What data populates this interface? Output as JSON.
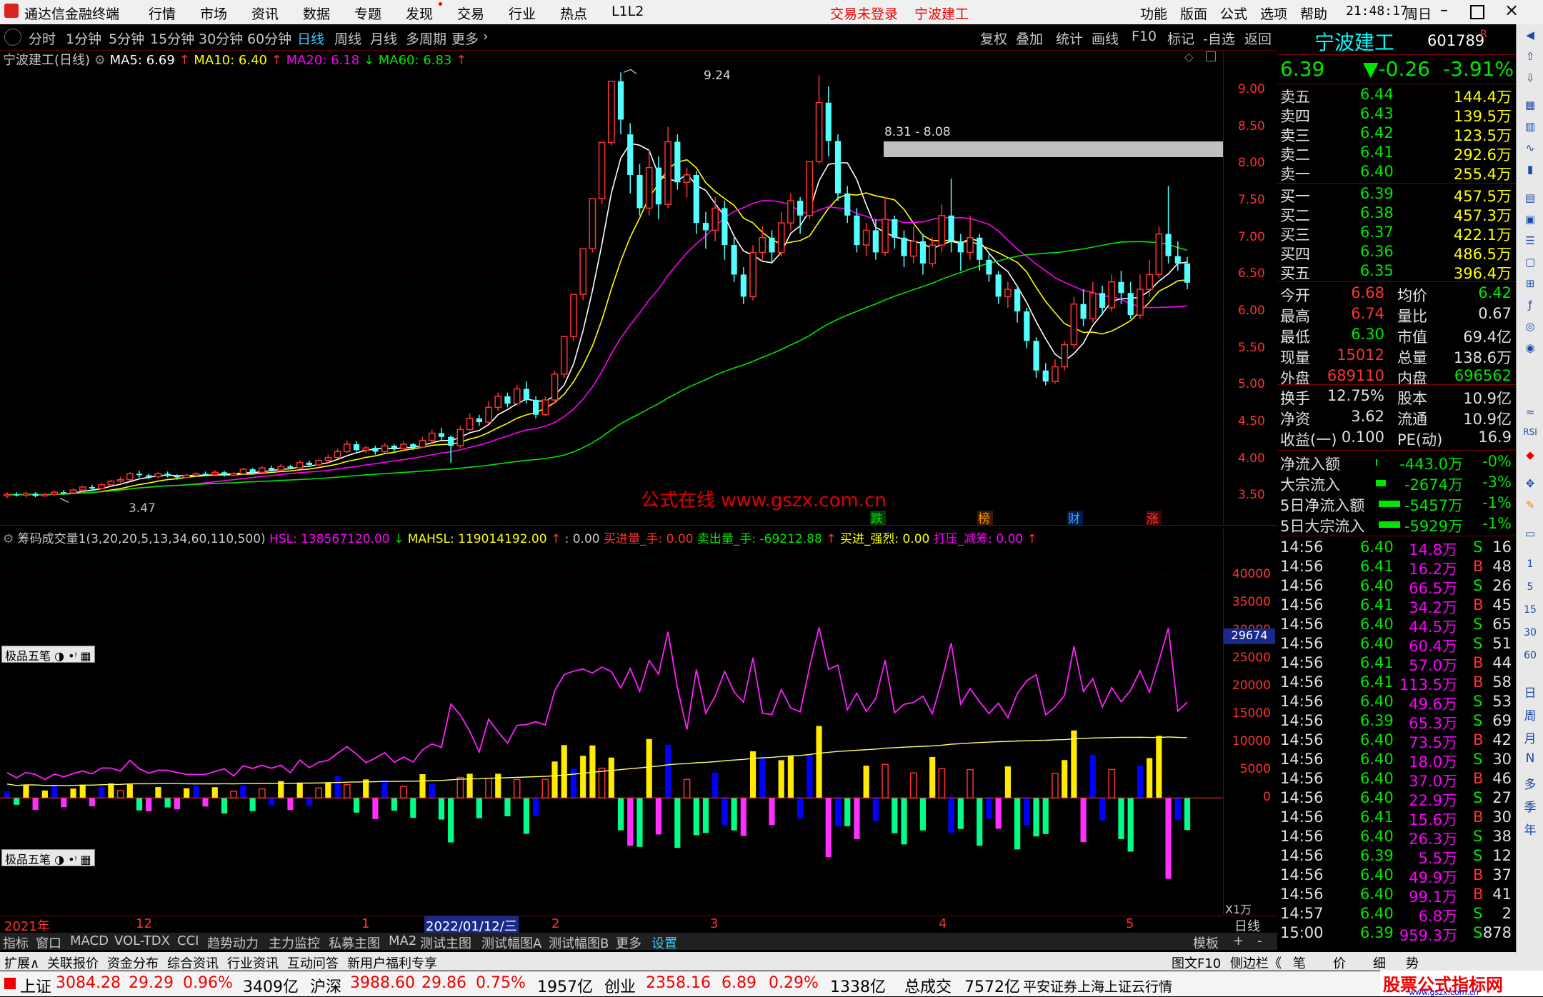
{
  "titlebar": {
    "app_name": "通达信金融终端",
    "menu": [
      "行情",
      "市场",
      "资讯",
      "数据",
      "专题",
      "发现",
      "交易",
      "行业",
      "热点",
      "L1L2"
    ],
    "login_status": "交易未登录",
    "stock": "宁波建工",
    "right_menu": [
      "功能",
      "版面",
      "公式",
      "选项",
      "帮助"
    ],
    "clock": "21:48:17",
    "weekday": "周日"
  },
  "period_tabs": [
    "分时",
    "1分钟",
    "5分钟",
    "15分钟",
    "30分钟",
    "60分钟",
    "日线",
    "周线",
    "月线",
    "多周期",
    "更多"
  ],
  "period_active": "日线",
  "tools": [
    "复权",
    "叠加",
    "统计",
    "画线",
    "F10",
    "标记",
    "-自选",
    "返回"
  ],
  "main_legend": {
    "name": "宁波建工(日线)",
    "ma5": "MA5: 6.69",
    "ma10": "MA10: 6.40",
    "ma20": "MA20: 6.18",
    "ma60": "MA60: 6.83"
  },
  "price_axis": [
    "9.00",
    "8.50",
    "8.00",
    "7.50",
    "7.00",
    "6.50",
    "6.00",
    "5.50",
    "5.00",
    "4.50",
    "4.00",
    "3.50"
  ],
  "annotations": {
    "high": "9.24",
    "low": "3.47",
    "zone": "8.31 - 8.08",
    "watermark": "公式在线  www.gszx.com.cn",
    "events": [
      "跌",
      "榜",
      "财",
      "涨"
    ]
  },
  "sub_legend": {
    "name": "筹码成交量1(3,20,20,5,13,34,60,110,500)",
    "hsl": "HSL: 138567120.00",
    "mahsl": "MAHSL: 119014192.00",
    "zero": ": 0.00",
    "buy_in": "买进量_手: 0.00",
    "sell_out": "卖出量_手: -69212.88",
    "buy_strong": "买进_强烈: 0.00",
    "press": "打压_减筹: 0.00"
  },
  "sub_axis": [
    "40000",
    "35000",
    "30000",
    "25000",
    "20000",
    "15000",
    "10000",
    "5000",
    "0"
  ],
  "sub_marker": "29674",
  "x1wan": "X1万",
  "tool_label": "极品五笔",
  "date_axis": {
    "labels": [
      "2021年",
      "12",
      "1",
      "2022/01/12/三",
      "2",
      "3",
      "4",
      "5"
    ],
    "period": "日线"
  },
  "bottom_tabs": [
    "指标",
    "窗口",
    "MACD",
    "VOL-TDX",
    "CCI",
    "趋势动力",
    "主力监控",
    "私募主图",
    "MA2",
    "测试主图",
    "测试幅图A",
    "测试幅图B",
    "更多",
    "设置"
  ],
  "bottom_right": [
    "模板",
    "+",
    "-"
  ],
  "ext_bar": [
    "扩展∧",
    "关联报价",
    "资金分布",
    "综合资讯",
    "行业资讯",
    "互动问答",
    "新用户福利专享"
  ],
  "ext_right": [
    "图文F10",
    "侧边栏《",
    "笔",
    "价",
    "细",
    "势"
  ],
  "stock_panel": {
    "name": "宁波建工",
    "code": "601789",
    "badge": "R",
    "price": "6.39",
    "change": "▼-0.26",
    "pct": "-3.91%",
    "asks": [
      {
        "label": "卖五",
        "price": "6.44",
        "vol": "144.4万"
      },
      {
        "label": "卖四",
        "price": "6.43",
        "vol": "139.5万"
      },
      {
        "label": "卖三",
        "price": "6.42",
        "vol": "123.5万"
      },
      {
        "label": "卖二",
        "price": "6.41",
        "vol": "292.6万"
      },
      {
        "label": "卖一",
        "price": "6.40",
        "vol": "255.4万"
      }
    ],
    "bids": [
      {
        "label": "买一",
        "price": "6.39",
        "vol": "457.5万"
      },
      {
        "label": "买二",
        "price": "6.38",
        "vol": "457.3万"
      },
      {
        "label": "买三",
        "price": "6.37",
        "vol": "422.1万"
      },
      {
        "label": "买四",
        "price": "6.36",
        "vol": "486.5万"
      },
      {
        "label": "买五",
        "price": "6.35",
        "vol": "396.4万"
      }
    ],
    "stats": [
      {
        "l1": "今开",
        "v1": "6.68",
        "l2": "均价",
        "v2": "6.42"
      },
      {
        "l1": "最高",
        "v1": "6.74",
        "l2": "量比",
        "v2": "0.67"
      },
      {
        "l1": "最低",
        "v1": "6.30",
        "l2": "市值",
        "v2": "69.4亿"
      },
      {
        "l1": "现量",
        "v1": "15012",
        "l2": "总量",
        "v2": "138.6万"
      },
      {
        "l1": "外盘",
        "v1": "689110",
        "l2": "内盘",
        "v2": "696562"
      }
    ],
    "stats2": [
      {
        "l1": "换手",
        "v1": "12.75%",
        "l2": "股本",
        "v2": "10.9亿"
      },
      {
        "l1": "净资",
        "v1": "3.62",
        "l2": "流通",
        "v2": "10.9亿"
      },
      {
        "l1": "收益(一)",
        "v1": "0.100",
        "l2": "PE(动)",
        "v2": "16.9"
      }
    ],
    "flows": [
      {
        "label": "净流入额",
        "value": "-443.0万",
        "pct": "-0%"
      },
      {
        "label": "大宗流入",
        "value": "-2674万",
        "pct": "-3%"
      },
      {
        "label": "5日净流入额",
        "value": "-5457万",
        "pct": "-1%"
      },
      {
        "label": "5日大宗流入",
        "value": "-5929万",
        "pct": "-1%"
      }
    ],
    "ticks": [
      [
        "14:56",
        "6.40",
        "14.8万",
        "S",
        "16"
      ],
      [
        "14:56",
        "6.41",
        "16.2万",
        "B",
        "48"
      ],
      [
        "14:56",
        "6.40",
        "66.5万",
        "S",
        "26"
      ],
      [
        "14:56",
        "6.41",
        "34.2万",
        "B",
        "45"
      ],
      [
        "14:56",
        "6.40",
        "44.5万",
        "S",
        "65"
      ],
      [
        "14:56",
        "6.40",
        "60.4万",
        "S",
        "51"
      ],
      [
        "14:56",
        "6.41",
        "57.0万",
        "B",
        "44"
      ],
      [
        "14:56",
        "6.41",
        "113.5万",
        "B",
        "58"
      ],
      [
        "14:56",
        "6.40",
        "49.6万",
        "S",
        "53"
      ],
      [
        "14:56",
        "6.39",
        "65.3万",
        "S",
        "69"
      ],
      [
        "14:56",
        "6.40",
        "73.5万",
        "B",
        "42"
      ],
      [
        "14:56",
        "6.40",
        "18.0万",
        "S",
        "30"
      ],
      [
        "14:56",
        "6.40",
        "37.0万",
        "B",
        "46"
      ],
      [
        "14:56",
        "6.40",
        "22.9万",
        "S",
        "27"
      ],
      [
        "14:56",
        "6.41",
        "15.6万",
        "B",
        "30"
      ],
      [
        "14:56",
        "6.40",
        "26.3万",
        "S",
        "38"
      ],
      [
        "14:56",
        "6.39",
        "5.5万",
        "S",
        "12"
      ],
      [
        "14:56",
        "6.40",
        "49.9万",
        "B",
        "37"
      ],
      [
        "14:56",
        "6.40",
        "99.1万",
        "B",
        "41"
      ],
      [
        "14:57",
        "6.40",
        "6.8万",
        "S",
        "2"
      ],
      [
        "15:00",
        "6.39",
        "959.3万",
        "S",
        "878"
      ]
    ]
  },
  "right_sidebar": [
    "日",
    "周",
    "月",
    "N",
    "多",
    "季",
    "年"
  ],
  "right_sidebar_nums": [
    "1",
    "5",
    "15",
    "30",
    "60"
  ],
  "index_bar": {
    "sh_label": "上证",
    "sh": "3084.28",
    "sh_chg": "29.29",
    "sh_pct": "0.96%",
    "sh_amt": "3409亿",
    "sz_label": "沪深",
    "sz": "3988.60",
    "sz_chg": "29.86",
    "sz_pct": "0.75%",
    "sz_amt": "1957亿",
    "cy_label": "创业",
    "cy": "2358.16",
    "cy_chg": "6.89",
    "cy_pct": "0.29%",
    "cy_amt": "1338亿",
    "total_label": "总成交",
    "total": "7572亿",
    "broker": "平安证券上海上证云行情",
    "brand": "股票公式指标网",
    "brand_url": "www.gszx.com.cn"
  },
  "chart_data": {
    "type": "candlestick",
    "ylim": [
      3.3,
      9.35
    ],
    "candles": [
      [
        3.5,
        3.52,
        3.47,
        3.55
      ],
      [
        3.52,
        3.51,
        3.49,
        3.55
      ],
      [
        3.51,
        3.53,
        3.48,
        3.56
      ],
      [
        3.53,
        3.5,
        3.48,
        3.55
      ],
      [
        3.5,
        3.52,
        3.49,
        3.54
      ],
      [
        3.52,
        3.55,
        3.5,
        3.57
      ],
      [
        3.55,
        3.54,
        3.52,
        3.58
      ],
      [
        3.54,
        3.58,
        3.53,
        3.6
      ],
      [
        3.58,
        3.62,
        3.56,
        3.64
      ],
      [
        3.62,
        3.6,
        3.58,
        3.65
      ],
      [
        3.6,
        3.65,
        3.59,
        3.68
      ],
      [
        3.65,
        3.7,
        3.63,
        3.72
      ],
      [
        3.7,
        3.72,
        3.68,
        3.76
      ],
      [
        3.72,
        3.8,
        3.7,
        3.82
      ],
      [
        3.8,
        3.78,
        3.75,
        3.84
      ],
      [
        3.78,
        3.76,
        3.73,
        3.8
      ],
      [
        3.76,
        3.8,
        3.74,
        3.82
      ],
      [
        3.8,
        3.77,
        3.75,
        3.83
      ],
      [
        3.77,
        3.75,
        3.72,
        3.79
      ],
      [
        3.75,
        3.78,
        3.74,
        3.8
      ],
      [
        3.78,
        3.8,
        3.76,
        3.82
      ],
      [
        3.8,
        3.79,
        3.77,
        3.83
      ],
      [
        3.79,
        3.82,
        3.78,
        3.85
      ],
      [
        3.82,
        3.78,
        3.76,
        3.84
      ],
      [
        3.78,
        3.8,
        3.77,
        3.82
      ],
      [
        3.8,
        3.86,
        3.79,
        3.88
      ],
      [
        3.86,
        3.82,
        3.8,
        3.88
      ],
      [
        3.82,
        3.88,
        3.81,
        3.9
      ],
      [
        3.88,
        3.85,
        3.83,
        3.91
      ],
      [
        3.85,
        3.9,
        3.84,
        3.93
      ],
      [
        3.9,
        3.88,
        3.86,
        3.92
      ],
      [
        3.88,
        3.95,
        3.87,
        3.98
      ],
      [
        3.95,
        3.92,
        3.9,
        3.98
      ],
      [
        3.92,
        3.98,
        3.9,
        4.0
      ],
      [
        3.98,
        4.02,
        3.95,
        4.06
      ],
      [
        4.02,
        4.1,
        4.0,
        4.14
      ],
      [
        4.1,
        4.2,
        4.08,
        4.25
      ],
      [
        4.2,
        4.12,
        4.1,
        4.24
      ],
      [
        4.12,
        4.15,
        4.08,
        4.18
      ],
      [
        4.15,
        4.1,
        4.06,
        4.18
      ],
      [
        4.1,
        4.18,
        4.08,
        4.22
      ],
      [
        4.18,
        4.14,
        4.1,
        4.2
      ],
      [
        4.14,
        4.2,
        4.12,
        4.24
      ],
      [
        4.2,
        4.16,
        4.12,
        4.22
      ],
      [
        4.16,
        4.25,
        4.15,
        4.3
      ],
      [
        4.25,
        4.35,
        4.22,
        4.4
      ],
      [
        4.35,
        4.3,
        4.25,
        4.42
      ],
      [
        4.3,
        4.18,
        3.95,
        4.32
      ],
      [
        4.18,
        4.4,
        4.15,
        4.45
      ],
      [
        4.4,
        4.55,
        4.38,
        4.62
      ],
      [
        4.55,
        4.5,
        4.45,
        4.6
      ],
      [
        4.5,
        4.7,
        4.48,
        4.78
      ],
      [
        4.7,
        4.85,
        4.65,
        4.9
      ],
      [
        4.85,
        4.75,
        4.7,
        4.9
      ],
      [
        4.75,
        4.95,
        4.72,
        5.0
      ],
      [
        4.95,
        4.8,
        4.75,
        5.05
      ],
      [
        4.8,
        4.6,
        4.55,
        4.85
      ],
      [
        4.6,
        4.8,
        4.58,
        4.85
      ],
      [
        4.8,
        5.15,
        4.75,
        5.2
      ],
      [
        5.15,
        5.66,
        5.1,
        5.66
      ],
      [
        5.66,
        6.23,
        5.6,
        6.23
      ],
      [
        6.23,
        6.85,
        6.15,
        6.85
      ],
      [
        6.85,
        7.53,
        6.8,
        7.53
      ],
      [
        7.53,
        8.29,
        7.45,
        8.29
      ],
      [
        8.29,
        9.12,
        8.25,
        9.12
      ],
      [
        9.12,
        8.6,
        8.4,
        9.24
      ],
      [
        8.4,
        7.85,
        7.6,
        8.55
      ],
      [
        7.85,
        7.4,
        7.3,
        8.0
      ],
      [
        7.4,
        7.95,
        7.3,
        8.2
      ],
      [
        7.95,
        7.45,
        7.25,
        8.1
      ],
      [
        7.45,
        8.3,
        7.4,
        8.5
      ],
      [
        8.3,
        7.75,
        7.65,
        8.4
      ],
      [
        7.75,
        7.85,
        7.55,
        7.95
      ],
      [
        7.85,
        7.2,
        7.05,
        7.9
      ],
      [
        7.2,
        7.1,
        6.85,
        7.35
      ],
      [
        7.1,
        7.4,
        6.95,
        7.55
      ],
      [
        7.4,
        6.9,
        6.7,
        7.5
      ],
      [
        6.9,
        6.5,
        6.4,
        7.0
      ],
      [
        6.5,
        6.2,
        6.1,
        6.6
      ],
      [
        6.2,
        6.8,
        6.15,
        6.9
      ],
      [
        6.8,
        7.0,
        6.7,
        7.15
      ],
      [
        7.0,
        6.8,
        6.65,
        7.1
      ],
      [
        6.8,
        7.2,
        6.75,
        7.35
      ],
      [
        7.2,
        7.5,
        7.1,
        7.6
      ],
      [
        7.5,
        7.3,
        7.05,
        7.55
      ],
      [
        7.3,
        8.03,
        7.25,
        8.03
      ],
      [
        8.03,
        8.83,
        8.0,
        9.2
      ],
      [
        8.83,
        8.31,
        8.1,
        9.05
      ],
      [
        8.31,
        7.6,
        7.5,
        8.4
      ],
      [
        7.6,
        7.3,
        7.2,
        7.7
      ],
      [
        7.3,
        6.9,
        6.8,
        7.4
      ],
      [
        6.9,
        7.1,
        6.75,
        7.2
      ],
      [
        7.1,
        6.8,
        6.7,
        7.25
      ],
      [
        6.8,
        7.25,
        6.75,
        7.55
      ],
      [
        7.25,
        7.0,
        6.85,
        7.3
      ],
      [
        7.0,
        6.75,
        6.6,
        7.1
      ],
      [
        6.75,
        6.95,
        6.65,
        7.15
      ],
      [
        6.95,
        6.65,
        6.5,
        7.05
      ],
      [
        6.65,
        6.9,
        6.6,
        7.0
      ],
      [
        6.9,
        7.3,
        6.8,
        7.45
      ],
      [
        7.3,
        6.95,
        6.8,
        7.8
      ],
      [
        6.95,
        6.8,
        6.55,
        7.05
      ],
      [
        6.8,
        7.0,
        6.7,
        7.3
      ],
      [
        7.0,
        6.7,
        6.55,
        7.05
      ],
      [
        6.7,
        6.5,
        6.4,
        6.8
      ],
      [
        6.5,
        6.2,
        6.1,
        6.55
      ],
      [
        6.2,
        6.3,
        6.05,
        6.4
      ],
      [
        6.3,
        6.0,
        5.85,
        6.35
      ],
      [
        6.0,
        5.6,
        5.5,
        6.05
      ],
      [
        5.6,
        5.2,
        5.1,
        5.65
      ],
      [
        5.2,
        5.05,
        5.0,
        5.3
      ],
      [
        5.05,
        5.25,
        5.02,
        5.35
      ],
      [
        5.25,
        5.55,
        5.2,
        5.6
      ],
      [
        5.55,
        6.1,
        5.5,
        6.2
      ],
      [
        6.1,
        5.9,
        5.8,
        6.3
      ],
      [
        5.9,
        6.25,
        5.85,
        6.4
      ],
      [
        6.25,
        6.05,
        5.95,
        6.35
      ],
      [
        6.05,
        6.4,
        6.0,
        6.5
      ],
      [
        6.4,
        6.25,
        6.1,
        6.55
      ],
      [
        6.25,
        5.95,
        5.9,
        6.4
      ],
      [
        5.95,
        6.3,
        5.9,
        6.5
      ],
      [
        6.3,
        6.5,
        6.2,
        6.7
      ],
      [
        6.5,
        7.05,
        6.45,
        7.15
      ],
      [
        7.05,
        6.75,
        6.65,
        7.7
      ],
      [
        6.75,
        6.65,
        6.55,
        6.95
      ],
      [
        6.65,
        6.39,
        6.3,
        6.74
      ]
    ]
  }
}
